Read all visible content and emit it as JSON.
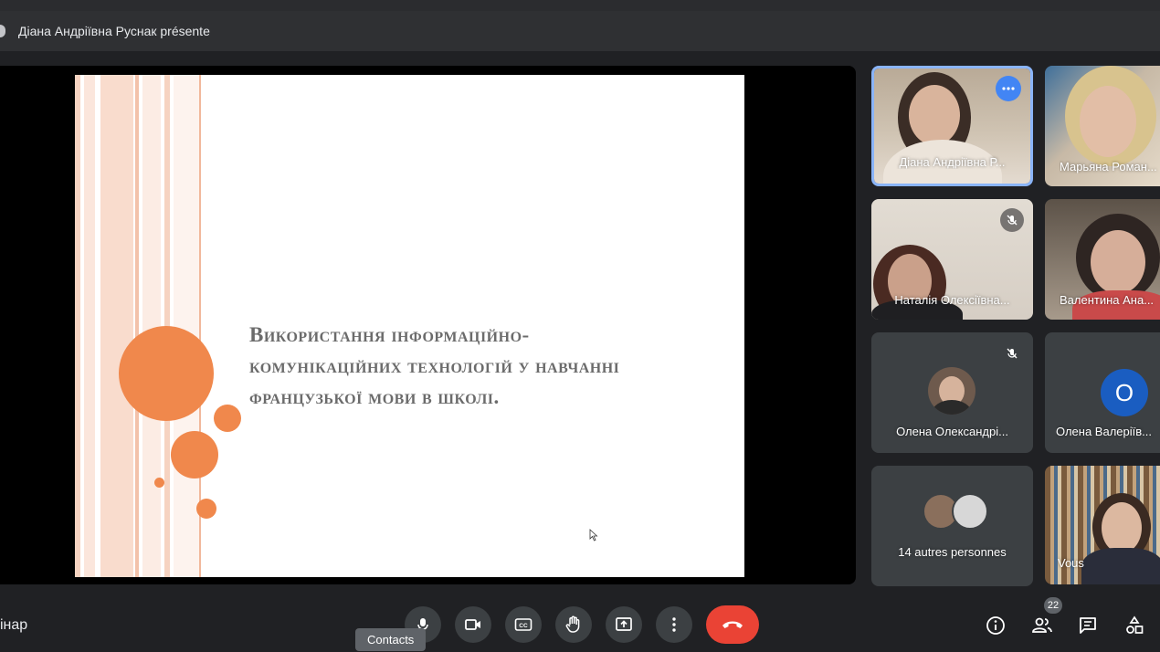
{
  "presenter": {
    "text": "Діана Андріївна Руснак présente"
  },
  "slide": {
    "title": "Використання інформаційно-комунікаційних технологій у навчанні французької мови в школі.",
    "accent_color": "#f0884c"
  },
  "participants": [
    {
      "name": "Діана Андріївна Р...",
      "state": "speaking",
      "icon": "more-options-icon"
    },
    {
      "name": "Марьяна Роман...",
      "state": "video"
    },
    {
      "name": "Наталія Олексіївна...",
      "state": "muted",
      "icon": "mic-off-icon"
    },
    {
      "name": "Валентина Ана...",
      "state": "video"
    },
    {
      "name": "Олена Олександрі...",
      "state": "muted",
      "icon": "mic-off-icon"
    },
    {
      "name": "Олена Валеріїв...",
      "avatar_letter": "О"
    },
    {
      "name": "14 autres personnes"
    },
    {
      "name": "Vous"
    }
  ],
  "bottom": {
    "meeting_name": "інар",
    "tooltip": "Contacts",
    "people_count": "22",
    "controls": [
      "mic-icon",
      "camera-icon",
      "captions-icon",
      "raise-hand-icon",
      "present-icon",
      "more-vert-icon",
      "end-call-icon"
    ],
    "right_icons": [
      "info-icon",
      "people-icon",
      "chat-icon",
      "activities-icon"
    ]
  }
}
